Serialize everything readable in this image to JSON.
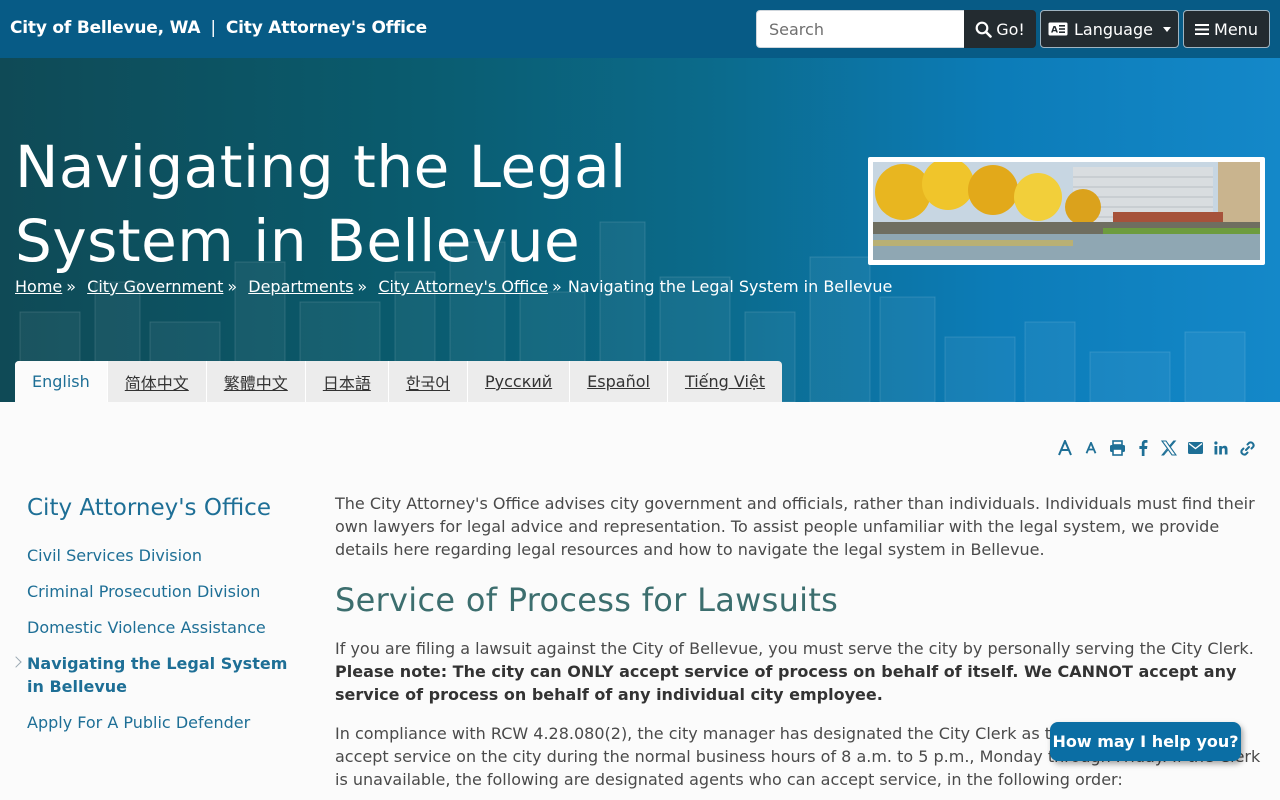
{
  "header": {
    "site_name": "City of Bellevue, WA",
    "separator": "|",
    "department": "City Attorney's Office",
    "search_placeholder": "Search",
    "go_label": "Go!",
    "language_label": "Language",
    "menu_label": "Menu"
  },
  "hero": {
    "title_line1": "Navigating the Legal",
    "title_line2": "System in Bellevue",
    "breadcrumb": {
      "home": "Home",
      "city_government": "City Government",
      "departments": "Departments",
      "city_attorney": "City Attorney's Office",
      "current": "Navigating the Legal System in Bellevue",
      "separator": "»"
    }
  },
  "language_tabs": [
    "English",
    "简体中文",
    "繁體中文",
    "日本語",
    "한국어",
    "Русский",
    "Español",
    "Tiếng Việt"
  ],
  "sidebar": {
    "title": "City Attorney's Office",
    "items": [
      {
        "label": "Civil Services Division"
      },
      {
        "label": "Criminal Prosecution Division"
      },
      {
        "label": "Domestic Violence Assistance"
      },
      {
        "label": "Navigating the Legal System in Bellevue"
      },
      {
        "label": "Apply For A Public Defender"
      }
    ]
  },
  "main": {
    "intro": "The City Attorney's Office advises city government and officials, rather than individuals. Individuals must find their own lawyers for legal advice and representation. To assist people unfamiliar with the legal system, we provide details here regarding legal resources and how to navigate the legal system in Bellevue.",
    "heading": "Service of Process for Lawsuits",
    "para1_plain": "If you are filing a lawsuit against the City of Bellevue, you must serve the city by personally serving the City Clerk. ",
    "para1_bold": "Please note: The city can ONLY accept service of process on behalf of itself. We CANNOT accept any service of process on behalf of any individual city employee.",
    "para2": "In compliance with RCW 4.28.080(2), the city manager has designated the City Clerk as the primary agent to accept service on the city during the normal business hours of 8 a.m. to 5 p.m., Monday through Friday. If the Clerk is unavailable, the following are designated agents who can accept service, in the following order:"
  },
  "help_widget": {
    "label": "How may I help you?"
  },
  "colors": {
    "topbar": "#075b86",
    "link": "#1e6f96",
    "heading": "#3c6e6e",
    "help": "#0b6ea4"
  }
}
